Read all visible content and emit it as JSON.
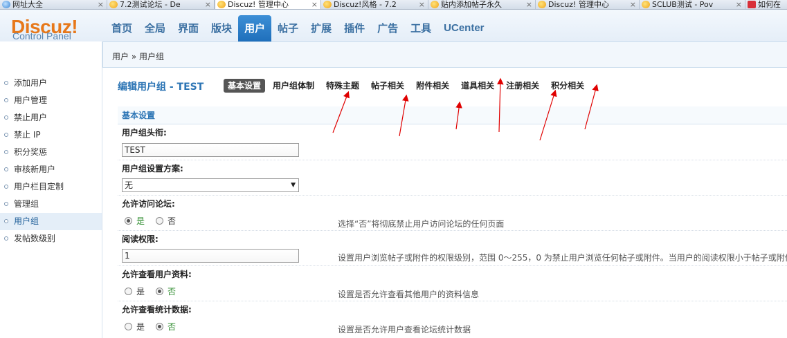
{
  "browser": {
    "tabs": [
      {
        "title": "网址大全",
        "icon": "globe-icon"
      },
      {
        "title": "7.2测试论坛 - De",
        "icon": "discuz-icon"
      },
      {
        "title": "Discuz! 管理中心",
        "icon": "discuz-icon",
        "active": true
      },
      {
        "title": "Discuz!风格 - 7.2",
        "icon": "discuz-icon"
      },
      {
        "title": "贴内添加帖子永久",
        "icon": "discuz-icon"
      },
      {
        "title": "Discuz! 管理中心",
        "icon": "discuz-icon"
      },
      {
        "title": "SCLUB测试 - Pov",
        "icon": "discuz-icon"
      },
      {
        "title": "如何在",
        "icon": "baidu-icon"
      }
    ],
    "close_glyph": "×"
  },
  "header": {
    "logo": "Discuz!",
    "logo_sub": "Control Panel",
    "nav": [
      "首页",
      "全局",
      "界面",
      "版块",
      "用户",
      "帖子",
      "扩展",
      "插件",
      "广告",
      "工具",
      "UCenter"
    ],
    "active_nav": "用户"
  },
  "breadcrumb": "用户 » 用户组",
  "sidebar": {
    "items": [
      "添加用户",
      "用户管理",
      "禁止用户",
      "禁止 IP",
      "积分奖惩",
      "审核新用户",
      "用户栏目定制",
      "管理组",
      "用户组",
      "发帖数级别"
    ],
    "active": "用户组"
  },
  "main": {
    "title": "编辑用户组 - TEST",
    "subtabs": [
      "基本设置",
      "用户组体制",
      "特殊主题",
      "帖子相关",
      "附件相关",
      "道具相关",
      "注册相关",
      "积分相关"
    ],
    "active_subtab": "基本设置",
    "section_title": "基本设置",
    "fields": [
      {
        "label": "用户组头衔:",
        "type": "text",
        "value": "TEST",
        "tip": ""
      },
      {
        "label": "用户组设置方案:",
        "type": "select",
        "value": "无",
        "tip": ""
      },
      {
        "label": "允许访问论坛:",
        "type": "radio",
        "options": [
          "是",
          "否"
        ],
        "selected": "是",
        "tip": "选择“否”将彻底禁止用户访问论坛的任何页面"
      },
      {
        "label": "阅读权限:",
        "type": "text",
        "value": "1",
        "tip": "设置用户浏览帖子或附件的权限级别，范围 0～255，0 为禁止用户浏览任何帖子或附件。当用户的阅读权限小于帖子或附件"
      },
      {
        "label": "允许查看用户资料:",
        "type": "radio",
        "options": [
          "是",
          "否"
        ],
        "selected": "否",
        "tip": "设置是否允许查看其他用户的资料信息"
      },
      {
        "label": "允许查看统计数据:",
        "type": "radio",
        "options": [
          "是",
          "否"
        ],
        "selected": "否",
        "tip": "设置是否允许用户查看论坛统计数据"
      }
    ]
  },
  "colors": {
    "accent": "#2b74b4",
    "nav_active": "#2f80c9",
    "logo": "#e7781a",
    "annotation": "#e00000"
  }
}
